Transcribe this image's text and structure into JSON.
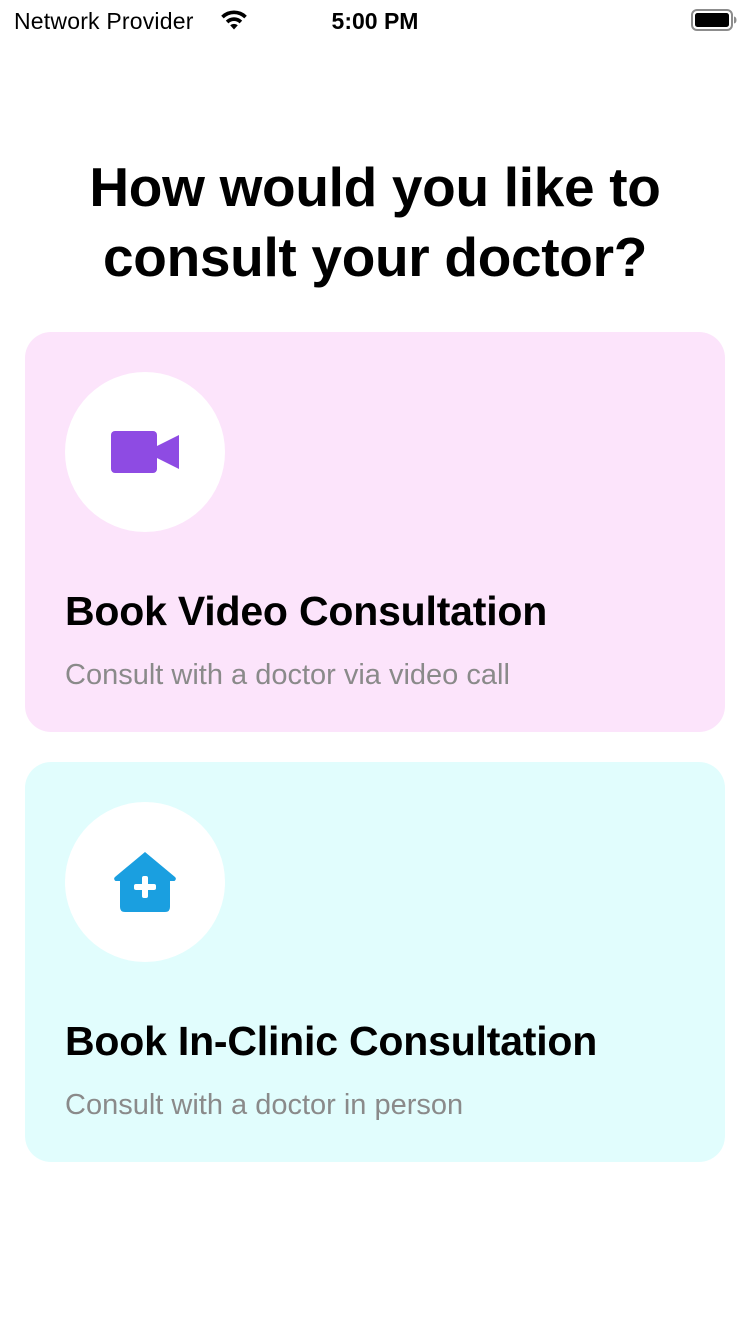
{
  "status_bar": {
    "carrier": "Network Provider",
    "time": "5:00 PM",
    "wifi_icon": "wifi-icon",
    "battery_icon": "battery-full-icon"
  },
  "heading": {
    "line1": "How would you like to",
    "line2": "consult your doctor?"
  },
  "options": [
    {
      "title": "Book Video Consultation",
      "subtitle": "Consult with a doctor via video call",
      "icon": "video-camera-icon",
      "background": "#fce4fb",
      "icon_color": "#8e4be3"
    },
    {
      "title": "Book In-Clinic Consultation",
      "subtitle": "Consult with a doctor in person",
      "icon": "clinic-house-plus-icon",
      "background": "#e1fdfd",
      "icon_color": "#1a9fe0"
    }
  ]
}
